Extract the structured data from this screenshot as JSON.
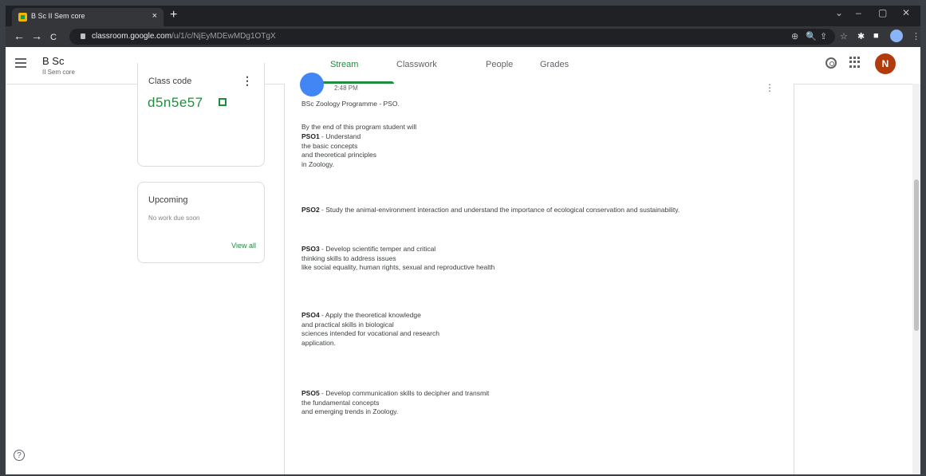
{
  "browser": {
    "tab_title": "B Sc II Sem core",
    "tab_close": "×",
    "new_tab": "+",
    "window_controls": [
      "⌄",
      "–",
      "▢",
      "✕"
    ],
    "nav": [
      "←",
      "→",
      "C"
    ],
    "url_host": "classroom.google.com",
    "url_path": "/u/1/c/NjEyMDEwMDg1OTgX",
    "toolbar_icons": [
      "⊕",
      "🔍",
      "⇪",
      "☆",
      "✱",
      "■"
    ]
  },
  "appbar": {
    "class_name": "B Sc",
    "class_section": "II Sem core",
    "tabs": [
      {
        "label": "Stream",
        "active": true
      },
      {
        "label": "Classwork",
        "active": false
      },
      {
        "label": "People",
        "active": false
      },
      {
        "label": "Grades",
        "active": false
      }
    ],
    "user_initial": "N"
  },
  "class_code": {
    "label": "Class code",
    "code": "d5n5e57",
    "more": "⋮"
  },
  "upcoming": {
    "title": "Upcoming",
    "none_text": "No work due soon",
    "view_all": "View all"
  },
  "post": {
    "time": "2:48 PM",
    "more": "⋮",
    "heading": "BSc Zoology Programme - PSO.",
    "intro": "By the end of this program student will",
    "pso1_code": "PSO1",
    "pso1_lines": [
      " - Understand",
      "the basic concepts",
      "and theoretical principles",
      "in Zoology."
    ],
    "pso2_code": "PSO2",
    "pso2_text": " - Study the animal-environment interaction and understand the importance of ecological conservation and sustainability.",
    "pso3_code": "PSO3",
    "pso3_lines": [
      " - Develop scientific temper and critical",
      "thinking skills to address issues",
      "like social equality, human rights, sexual and reproductive health"
    ],
    "pso4_code": "PSO4",
    "pso4_lines": [
      " - Apply the theoretical knowledge",
      "and practical skills in biological",
      "sciences intended for vocational and research",
      "application."
    ],
    "pso5_code": "PSO5",
    "pso5_lines": [
      " - Develop communication skills to decipher and transmit",
      "the fundamental concepts",
      "and emerging trends in Zoology."
    ]
  },
  "help": "?"
}
